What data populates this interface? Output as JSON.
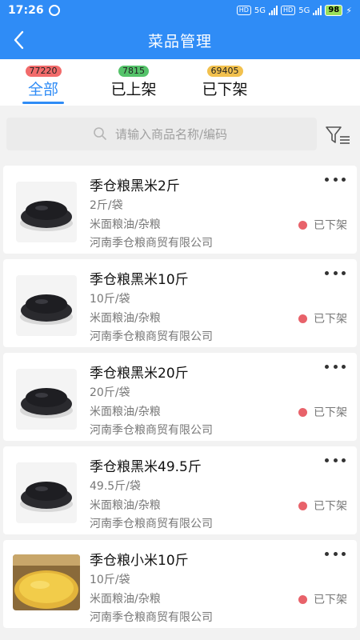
{
  "status_bar": {
    "time": "17:26",
    "hd1": "HD",
    "net1": "5G",
    "hd2": "HD",
    "net2": "5G",
    "battery": "98"
  },
  "navbar": {
    "title": "菜品管理"
  },
  "tabs": [
    {
      "badge": "77220",
      "label": "全部",
      "badge_color": "#f26b6b",
      "active": true
    },
    {
      "badge": "7815",
      "label": "已上架",
      "badge_color": "#55c36a",
      "active": false
    },
    {
      "badge": "69405",
      "label": "已下架",
      "badge_color": "#f2c14e",
      "active": false
    }
  ],
  "search": {
    "placeholder": "请输入商品名称/编码"
  },
  "colors": {
    "primary": "#2f8cf6",
    "status_dot": "#e8626a"
  },
  "products": [
    {
      "name": "季仓粮黑米2斤",
      "spec": "2斤/袋",
      "category": "米面粮油/杂粮",
      "company": "河南季仓粮商贸有限公司",
      "status": "已下架",
      "image": "black-rice-bowl"
    },
    {
      "name": "季仓粮黑米10斤",
      "spec": "10斤/袋",
      "category": "米面粮油/杂粮",
      "company": "河南季仓粮商贸有限公司",
      "status": "已下架",
      "image": "black-rice-bowl"
    },
    {
      "name": "季仓粮黑米20斤",
      "spec": "20斤/袋",
      "category": "米面粮油/杂粮",
      "company": "河南季仓粮商贸有限公司",
      "status": "已下架",
      "image": "black-rice-bowl"
    },
    {
      "name": "季仓粮黑米49.5斤",
      "spec": "49.5斤/袋",
      "category": "米面粮油/杂粮",
      "company": "河南季仓粮商贸有限公司",
      "status": "已下架",
      "image": "black-rice-bowl"
    },
    {
      "name": "季仓粮小米10斤",
      "spec": "10斤/袋",
      "category": "米面粮油/杂粮",
      "company": "河南季仓粮商贸有限公司",
      "status": "已下架",
      "image": "millet-bowl"
    }
  ]
}
